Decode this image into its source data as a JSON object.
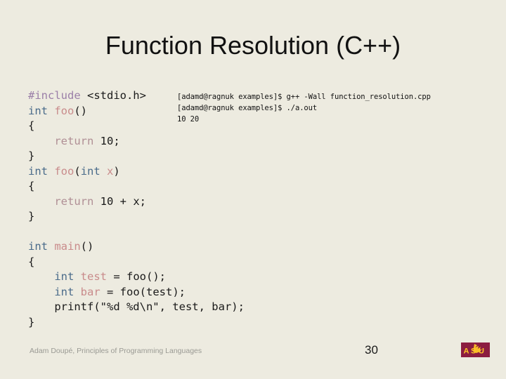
{
  "slide": {
    "title": "Function Resolution (C++)",
    "page_number": "30"
  },
  "code": {
    "language": "cpp",
    "lines": [
      [
        {
          "t": "#include",
          "c": "pre"
        },
        {
          "t": " <stdio.h>",
          "c": "plain"
        }
      ],
      [
        {
          "t": "int",
          "c": "kw"
        },
        {
          "t": " ",
          "c": "plain"
        },
        {
          "t": "foo",
          "c": "fn"
        },
        {
          "t": "()",
          "c": "plain"
        }
      ],
      [
        {
          "t": "{",
          "c": "plain"
        }
      ],
      [
        {
          "t": "    ",
          "c": "plain"
        },
        {
          "t": "return",
          "c": "ret"
        },
        {
          "t": " 10;",
          "c": "plain"
        }
      ],
      [
        {
          "t": "}",
          "c": "plain"
        }
      ],
      [
        {
          "t": "int",
          "c": "kw"
        },
        {
          "t": " ",
          "c": "plain"
        },
        {
          "t": "foo",
          "c": "fn"
        },
        {
          "t": "(",
          "c": "plain"
        },
        {
          "t": "int",
          "c": "kw"
        },
        {
          "t": " ",
          "c": "plain"
        },
        {
          "t": "x",
          "c": "var"
        },
        {
          "t": ")",
          "c": "plain"
        }
      ],
      [
        {
          "t": "{",
          "c": "plain"
        }
      ],
      [
        {
          "t": "    ",
          "c": "plain"
        },
        {
          "t": "return",
          "c": "ret"
        },
        {
          "t": " 10 + x;",
          "c": "plain"
        }
      ],
      [
        {
          "t": "}",
          "c": "plain"
        }
      ],
      [
        {
          "t": "",
          "c": "plain"
        }
      ],
      [
        {
          "t": "int",
          "c": "kw"
        },
        {
          "t": " ",
          "c": "plain"
        },
        {
          "t": "main",
          "c": "fn"
        },
        {
          "t": "()",
          "c": "plain"
        }
      ],
      [
        {
          "t": "{",
          "c": "plain"
        }
      ],
      [
        {
          "t": "    ",
          "c": "plain"
        },
        {
          "t": "int",
          "c": "kw"
        },
        {
          "t": " ",
          "c": "plain"
        },
        {
          "t": "test",
          "c": "var"
        },
        {
          "t": " = foo();",
          "c": "plain"
        }
      ],
      [
        {
          "t": "    ",
          "c": "plain"
        },
        {
          "t": "int",
          "c": "kw"
        },
        {
          "t": " ",
          "c": "plain"
        },
        {
          "t": "bar",
          "c": "var"
        },
        {
          "t": " = foo(test);",
          "c": "plain"
        }
      ],
      [
        {
          "t": "    printf(\"%d %d\\n\", test, bar);",
          "c": "plain"
        }
      ],
      [
        {
          "t": "}",
          "c": "plain"
        }
      ]
    ]
  },
  "terminal": {
    "lines": [
      "[adamd@ragnuk examples]$ g++ -Wall function_resolution.cpp",
      "[adamd@ragnuk examples]$ ./a.out",
      "10 20"
    ]
  },
  "footer": {
    "credit": "Adam Doupé, Principles of Programming Languages",
    "logo_text": "ASU"
  },
  "colors": {
    "background": "#EDEBE0",
    "title_text": "#111111",
    "code_text": "#1A1A1A",
    "preprocessor": "#9B7FA8",
    "keyword": "#4A6B8A",
    "function_name": "#C98B8B",
    "variable": "#C98B8B",
    "return_keyword": "#B08F95",
    "footer_text": "#9A9A94",
    "asu_maroon": "#8C1D40",
    "asu_gold": "#FFC627"
  }
}
